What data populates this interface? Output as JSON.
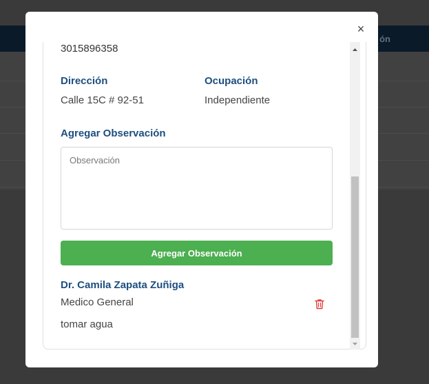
{
  "background": {
    "nav_text": "ón"
  },
  "modal": {
    "close_label": "×",
    "phone": "3015896358",
    "direccion_label": "Dirección",
    "direccion_value": "Calle 15C # 92-51",
    "ocupacion_label": "Ocupación",
    "ocupacion_value": "Independiente",
    "add_obs_label": "Agregar Observación",
    "obs_placeholder": "Observación",
    "add_obs_button": "Agregar Observación",
    "observations": [
      {
        "doctor": "Dr. Camila Zapata Zuñiga",
        "role": "Medico General",
        "note": "tomar agua"
      }
    ]
  },
  "colors": {
    "label_blue": "#1d4e80",
    "button_green": "#4caf50",
    "delete_red": "#e53935"
  },
  "icons": {
    "close": "close-icon",
    "delete": "trash-icon",
    "scroll_up": "chevron-up-icon",
    "scroll_down": "chevron-down-icon"
  }
}
